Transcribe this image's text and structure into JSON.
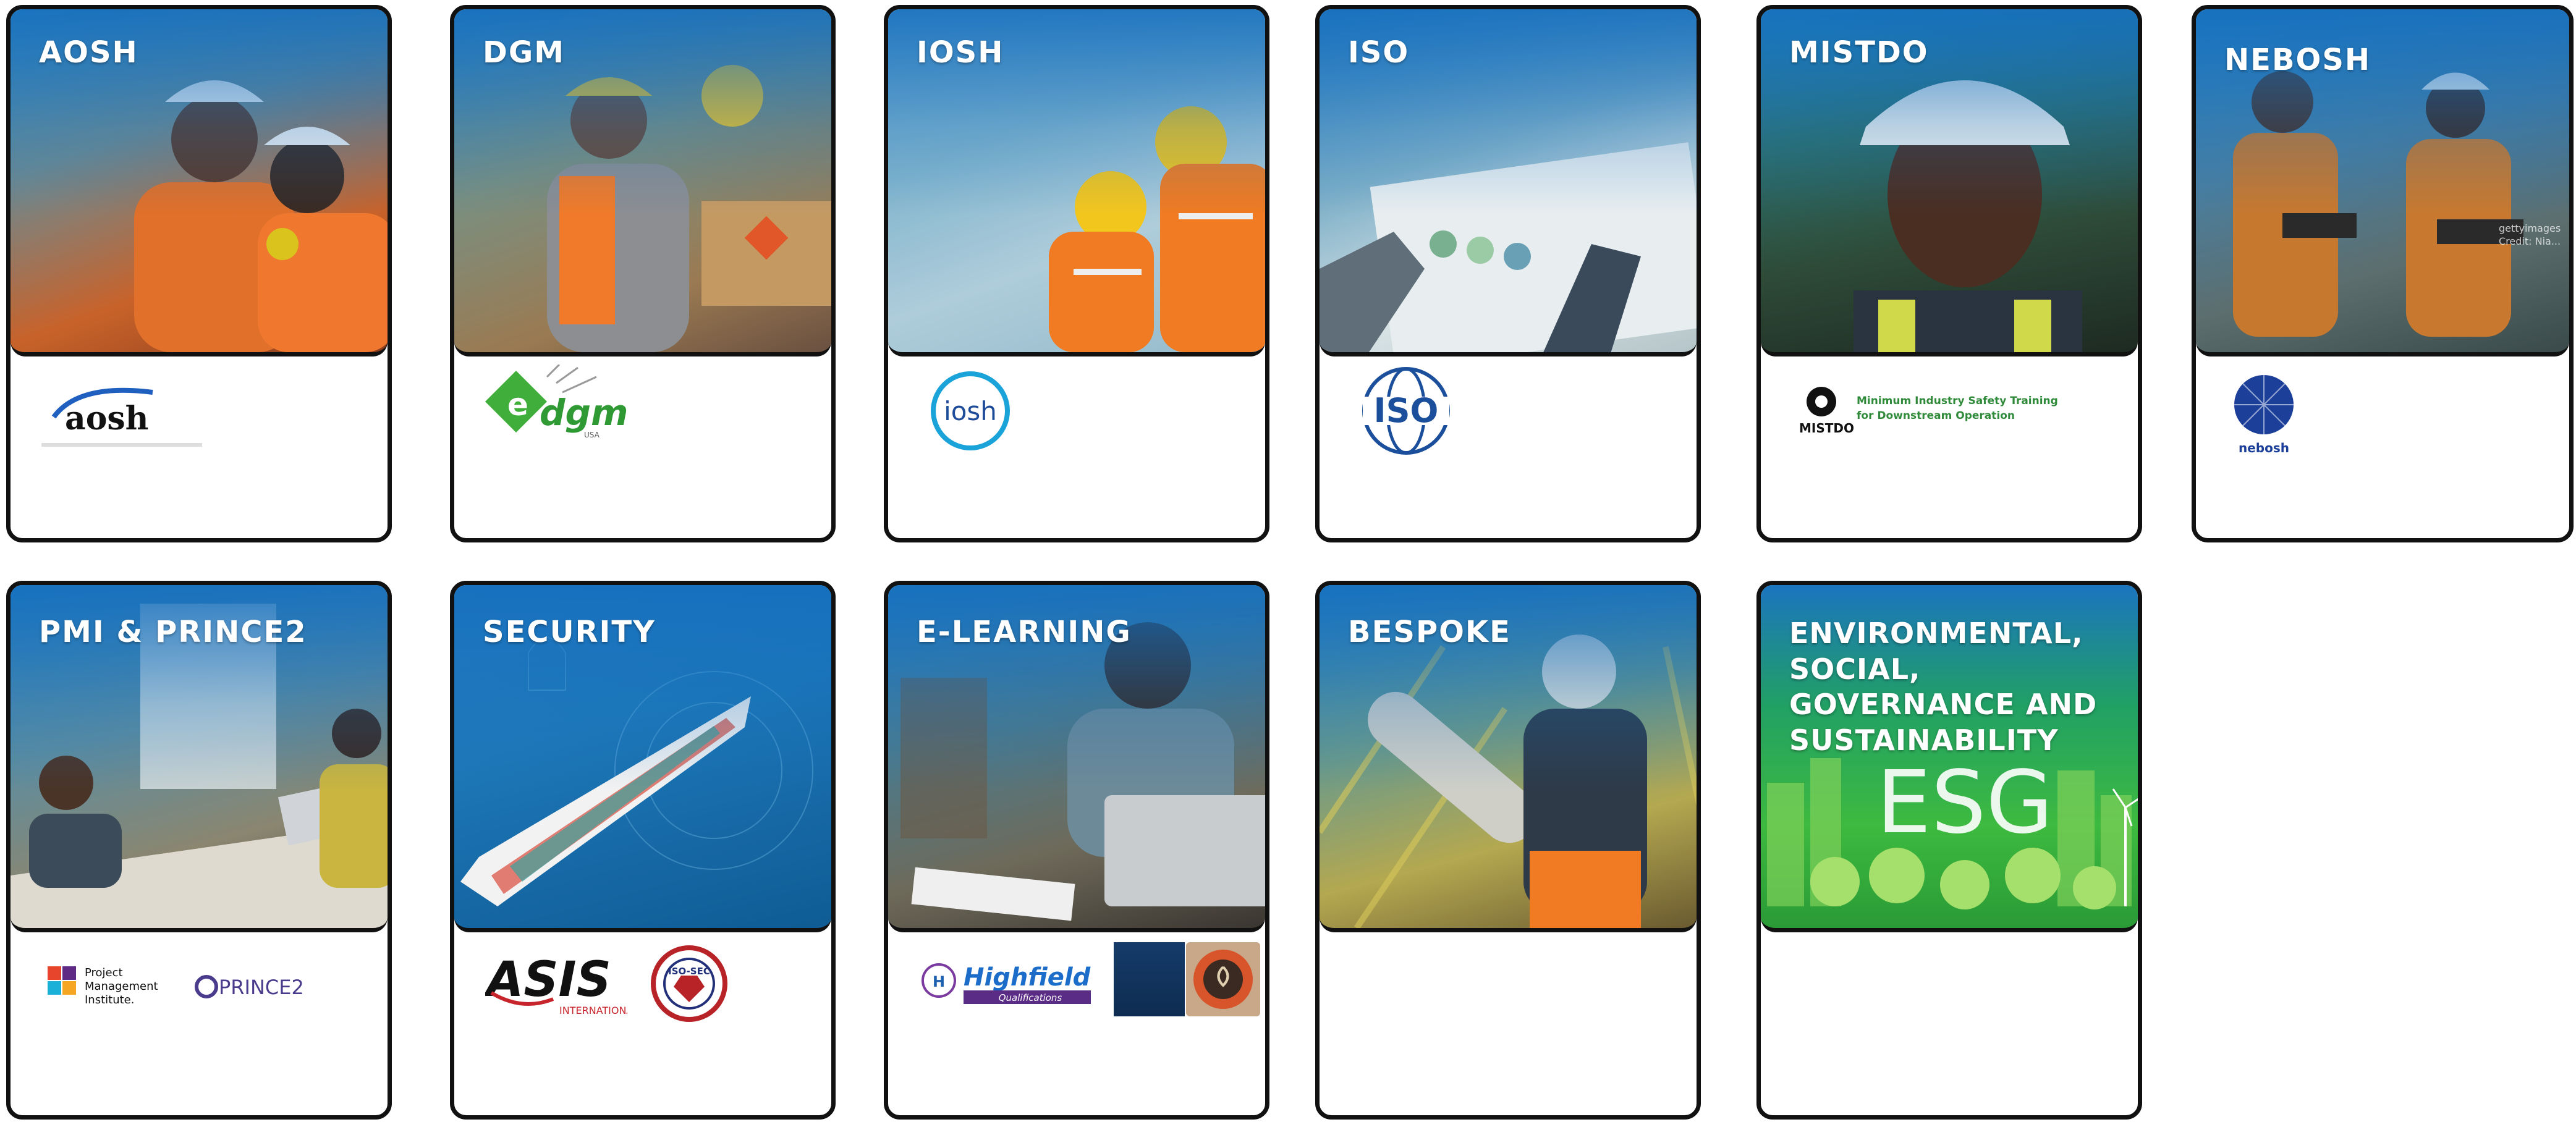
{
  "cards": [
    {
      "title": "AOSH",
      "logo": {
        "text": "aosh"
      }
    },
    {
      "title": "DGM",
      "logo": {
        "text": "dgm",
        "sub": "USA"
      }
    },
    {
      "title": "IOSH",
      "logo": {
        "text": "iosh"
      }
    },
    {
      "title": "ISO",
      "logo": {
        "text": "ISO"
      }
    },
    {
      "title": "MISTDO",
      "logo": {
        "text": "MISTDO",
        "line1": "Minimum Industry Safety Training",
        "line2": "for Downstream Operation"
      }
    },
    {
      "title": "NEBOSH",
      "logo": {
        "text": "nebosh"
      },
      "watermark": "gettyimages Credit: Nia..."
    },
    {
      "title": "PMI & PRINCE2",
      "logo": {
        "pmi_line1": "Project",
        "pmi_line2": "Management",
        "pmi_line3": "Institute.",
        "prince2": "PRINCE2"
      }
    },
    {
      "title": "SECURITY",
      "logo": {
        "asis": "ASIS",
        "asis_sub": "INTERNATIONAL",
        "isosec": "ISO-SEC"
      }
    },
    {
      "title": "E-LEARNING",
      "logo": {
        "highfield": "Highfield",
        "highfield_sub": "Qualifications"
      }
    },
    {
      "title": "BESPOKE"
    },
    {
      "title": "ENVIRONMENTAL, SOCIAL, GOVERNANCE AND SUSTAINABILITY",
      "image_text": "ESG"
    }
  ],
  "colors": {
    "brand_blue": "#1f6fb5",
    "border": "#111111",
    "esg_green": "#2fa84a"
  }
}
